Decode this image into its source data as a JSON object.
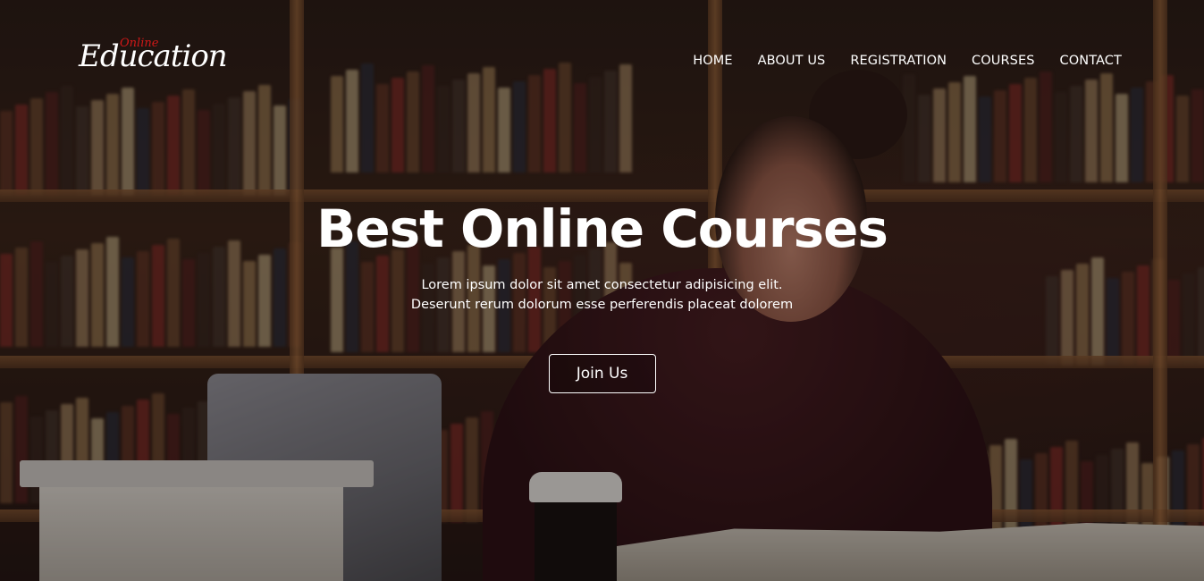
{
  "brand": {
    "logo_main": "Education",
    "logo_sub": "Online",
    "accent_color": "#d01818"
  },
  "nav": {
    "items": [
      {
        "label": "HOME"
      },
      {
        "label": "ABOUT US"
      },
      {
        "label": "REGISTRATION"
      },
      {
        "label": "COURSES"
      },
      {
        "label": "CONTACT"
      }
    ]
  },
  "hero": {
    "headline": "Best Online Courses",
    "subtext_line1": "Lorem ipsum dolor sit amet consectetur adipisicing elit.",
    "subtext_line2": "Deserunt rerum dolorum esse perferendis placeat dolorem",
    "cta_label": "Join Us"
  }
}
